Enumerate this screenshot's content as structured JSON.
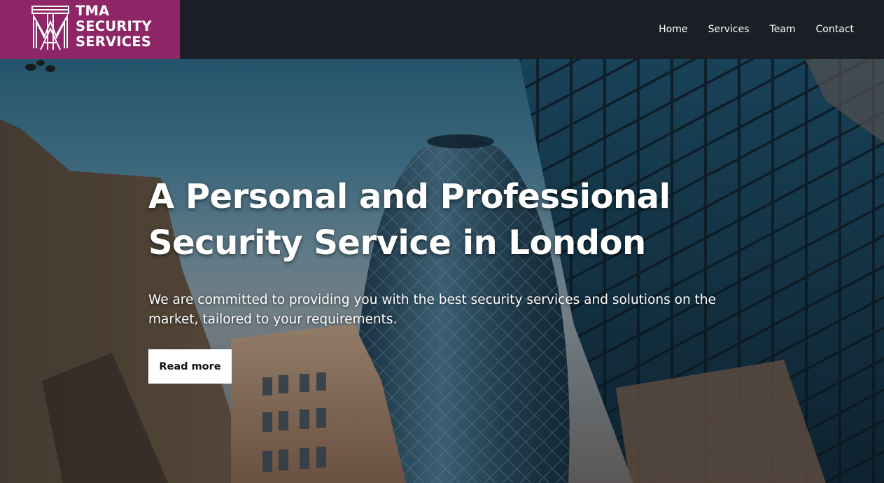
{
  "brand": {
    "logo_icon": "tma-monogram-icon",
    "name_lines": [
      "TMA",
      "SECURITY",
      "SERVICES"
    ],
    "color": "#8e2566"
  },
  "nav": {
    "items": [
      {
        "label": "Home"
      },
      {
        "label": "Services"
      },
      {
        "label": "Team"
      },
      {
        "label": "Contact"
      }
    ]
  },
  "hero": {
    "title_lines": [
      "A Personal and Professional",
      "Security Service in London"
    ],
    "subtitle": "We are committed to providing you with the best security services and solutions on the market, tailored to your requirements.",
    "cta_label": "Read more"
  },
  "colors": {
    "header_bg": "#1b1e24",
    "accent": "#8e2566",
    "button_bg": "#ffffff"
  }
}
